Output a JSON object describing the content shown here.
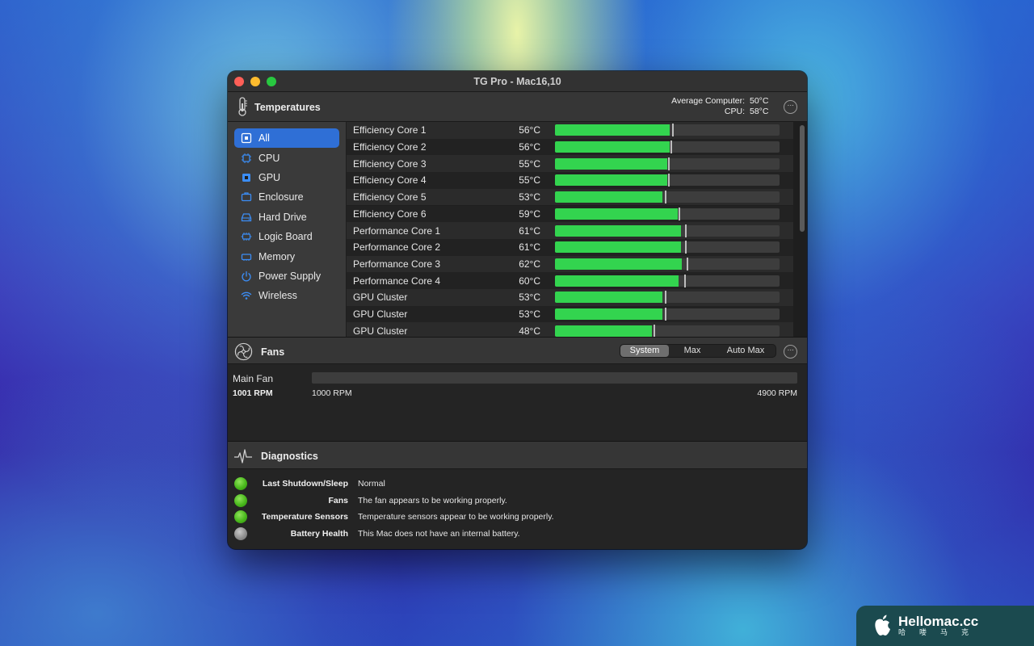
{
  "window": {
    "title": "TG Pro - Mac16,10"
  },
  "temperatures": {
    "title": "Temperatures",
    "avg_computer_label": "Average Computer:",
    "avg_computer_value": "50°C",
    "cpu_label": "CPU:",
    "cpu_value": "58°C",
    "more_label": "···"
  },
  "sidebar": {
    "items": [
      {
        "label": "All",
        "icon": "all-sensors-icon",
        "active": true
      },
      {
        "label": "CPU",
        "icon": "cpu-icon"
      },
      {
        "label": "GPU",
        "icon": "gpu-icon"
      },
      {
        "label": "Enclosure",
        "icon": "enclosure-icon"
      },
      {
        "label": "Hard Drive",
        "icon": "hard-drive-icon"
      },
      {
        "label": "Logic Board",
        "icon": "logic-board-icon"
      },
      {
        "label": "Memory",
        "icon": "memory-icon"
      },
      {
        "label": "Power Supply",
        "icon": "power-icon"
      },
      {
        "label": "Wireless",
        "icon": "wifi-icon"
      }
    ]
  },
  "sensors": [
    {
      "name": "Efficiency Core 1",
      "temp": "56°C",
      "level": 0.51,
      "peak": 0.52
    },
    {
      "name": "Efficiency Core 2",
      "temp": "56°C",
      "level": 0.51,
      "peak": 0.515
    },
    {
      "name": "Efficiency Core 3",
      "temp": "55°C",
      "level": 0.5,
      "peak": 0.505
    },
    {
      "name": "Efficiency Core 4",
      "temp": "55°C",
      "level": 0.5,
      "peak": 0.505
    },
    {
      "name": "Efficiency Core 5",
      "temp": "53°C",
      "level": 0.48,
      "peak": 0.49
    },
    {
      "name": "Efficiency Core 6",
      "temp": "59°C",
      "level": 0.545,
      "peak": 0.55
    },
    {
      "name": "Performance Core 1",
      "temp": "61°C",
      "level": 0.56,
      "peak": 0.58
    },
    {
      "name": "Performance Core 2",
      "temp": "61°C",
      "level": 0.56,
      "peak": 0.58
    },
    {
      "name": "Performance Core 3",
      "temp": "62°C",
      "level": 0.565,
      "peak": 0.585
    },
    {
      "name": "Performance Core 4",
      "temp": "60°C",
      "level": 0.55,
      "peak": 0.575
    },
    {
      "name": "GPU Cluster",
      "temp": "53°C",
      "level": 0.48,
      "peak": 0.49
    },
    {
      "name": "GPU Cluster",
      "temp": "53°C",
      "level": 0.48,
      "peak": 0.49
    },
    {
      "name": "GPU Cluster",
      "temp": "48°C",
      "level": 0.43,
      "peak": 0.44
    }
  ],
  "fans": {
    "title": "Fans",
    "modes": [
      "System",
      "Max",
      "Auto Max"
    ],
    "active_mode": "System",
    "more_label": "···",
    "main_fan_label": "Main Fan",
    "current_rpm": "1001 RPM",
    "min_rpm": "1000 RPM",
    "max_rpm": "4900 RPM"
  },
  "diagnostics": {
    "title": "Diagnostics",
    "items": [
      {
        "label": "Last Shutdown/Sleep",
        "text": "Normal",
        "status": "green"
      },
      {
        "label": "Fans",
        "text": "The fan appears to be working properly.",
        "status": "green"
      },
      {
        "label": "Temperature Sensors",
        "text": "Temperature sensors appear to be working properly.",
        "status": "green"
      },
      {
        "label": "Battery Health",
        "text": "This Mac does not have an internal battery.",
        "status": "gray"
      }
    ]
  },
  "watermark": {
    "name": "Hellomac.cc",
    "sub": "哈喽马克"
  },
  "colors": {
    "accent": "#2f6fd6",
    "bar_fill": "#33d44f",
    "status_green": "#49b81c",
    "status_gray": "#8a8a8a"
  }
}
